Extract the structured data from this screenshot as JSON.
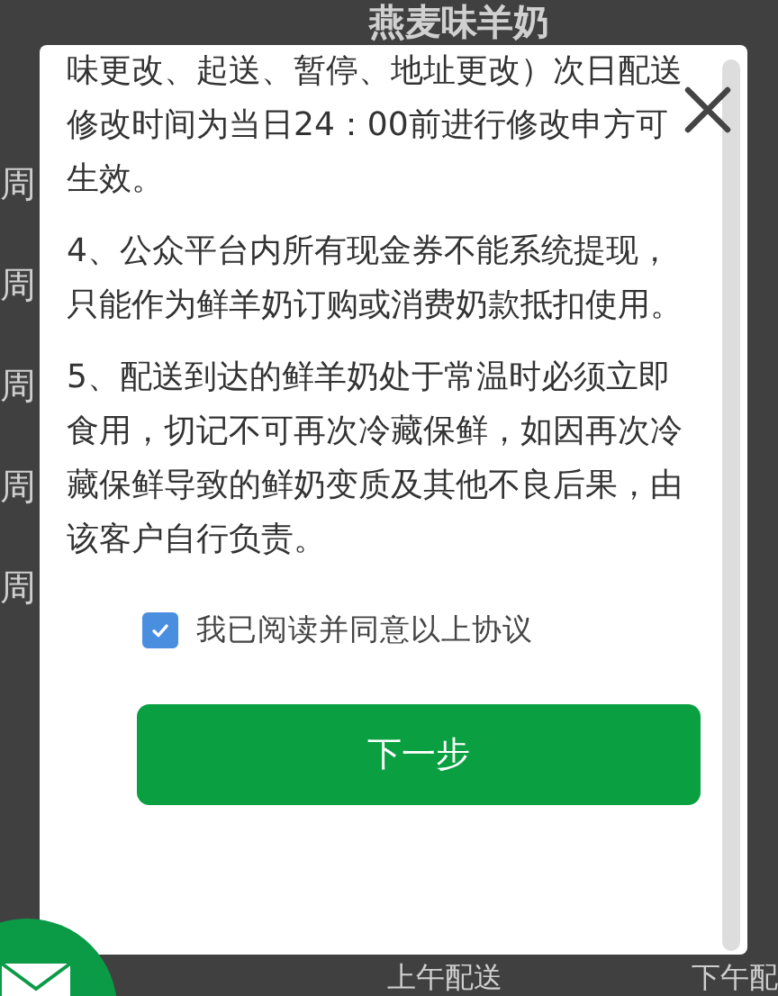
{
  "page": {
    "title": "燕麦味羊奶",
    "side_labels": [
      "周",
      "周",
      "周",
      "周",
      "周"
    ],
    "bottom_left": "上午配送",
    "bottom_right": "下午配"
  },
  "dialog": {
    "paragraphs": [
      "味更改、起送、暂停、地址更改）次日配送修改时间为当日24：00前进行修改申方可生效。",
      "4、公众平台内所有现金券不能系统提现，只能作为鲜羊奶订购或消费奶款抵扣使用。",
      "5、配送到达的鲜羊奶处于常温时必须立即食用，切记不可再次冷藏保鲜，如因再次冷藏保鲜导致的鲜奶变质及其他不良后果，由该客户自行负责。"
    ],
    "agree": {
      "label": "我已阅读并同意以上协议",
      "checked": true
    },
    "next_button": "下一步"
  }
}
